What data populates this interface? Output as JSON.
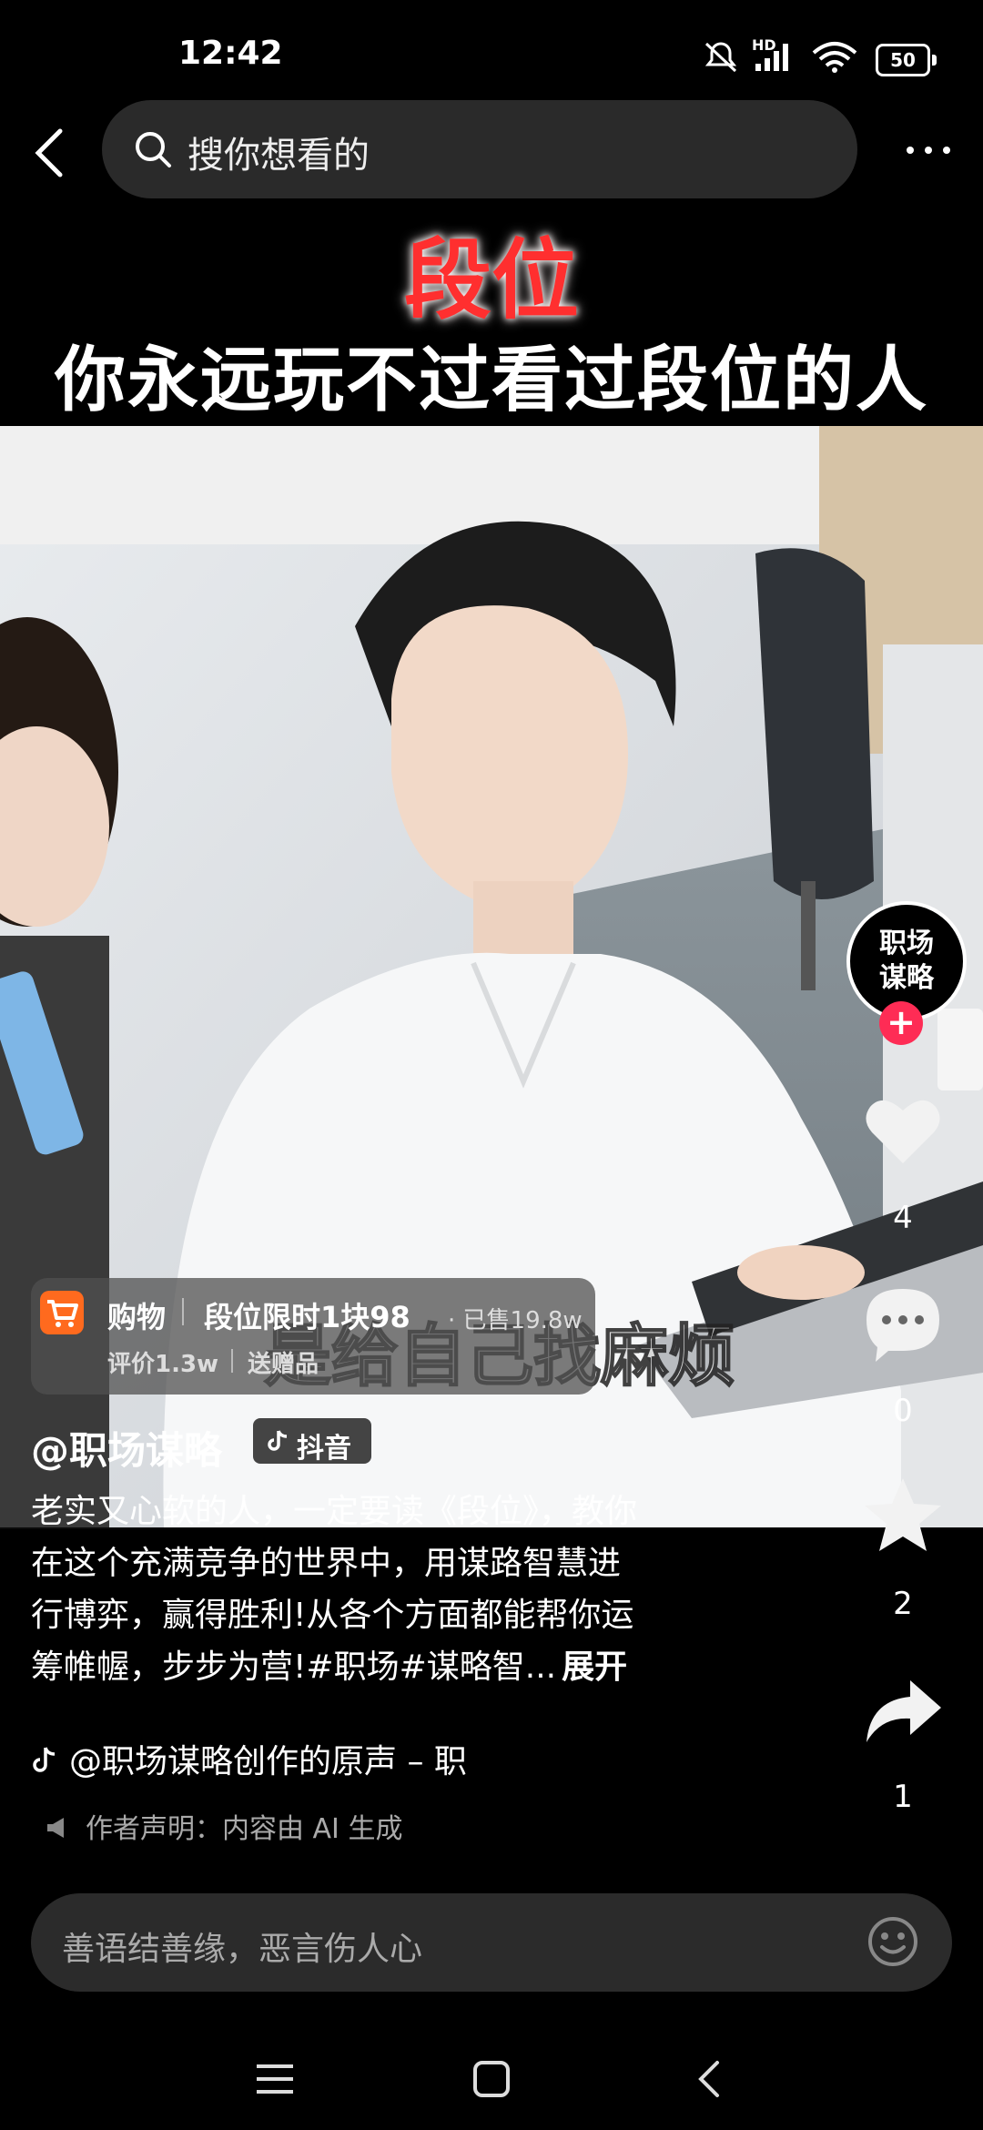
{
  "status_bar": {
    "time": "12:42",
    "network": "HD",
    "battery": "50"
  },
  "search": {
    "placeholder": "搜你想看的"
  },
  "video": {
    "cover_title_1": "段位",
    "cover_title_2": "你永远玩不过看过段位的人",
    "subtitle": "是给自己找麻烦"
  },
  "shop": {
    "label": "购物",
    "title": "段位限时1块98",
    "sold": "· 已售19.8w",
    "rating": "评价1.3w",
    "gift": "送赠品"
  },
  "author": {
    "name": "@职场谋略",
    "platform": "抖音"
  },
  "description": {
    "lines": [
      "老实又心软的人，一定要读《段位》，教你",
      "在这个充满竞争的世界中，用谋路智慧进",
      "行博弈，赢得胜利!从各个方面都能帮你运",
      "筹帷幄，步步为营!#职场#谋略智..."
    ],
    "expand": "展开"
  },
  "music": "@职场谋略创作的原声 – 职",
  "ai_notice": "作者声明：内容由 AI 生成",
  "right_rail": {
    "avatar_line1": "职场",
    "avatar_line2": "谋略",
    "follow": "+",
    "likes": "4",
    "comments": "0",
    "favorites": "2",
    "shares": "1"
  },
  "comment_bar": {
    "placeholder": "善语结善缘，恶言伤人心"
  },
  "colors": {
    "accent_red": "#fe2c55",
    "shop_orange": "#ff6a1e"
  }
}
